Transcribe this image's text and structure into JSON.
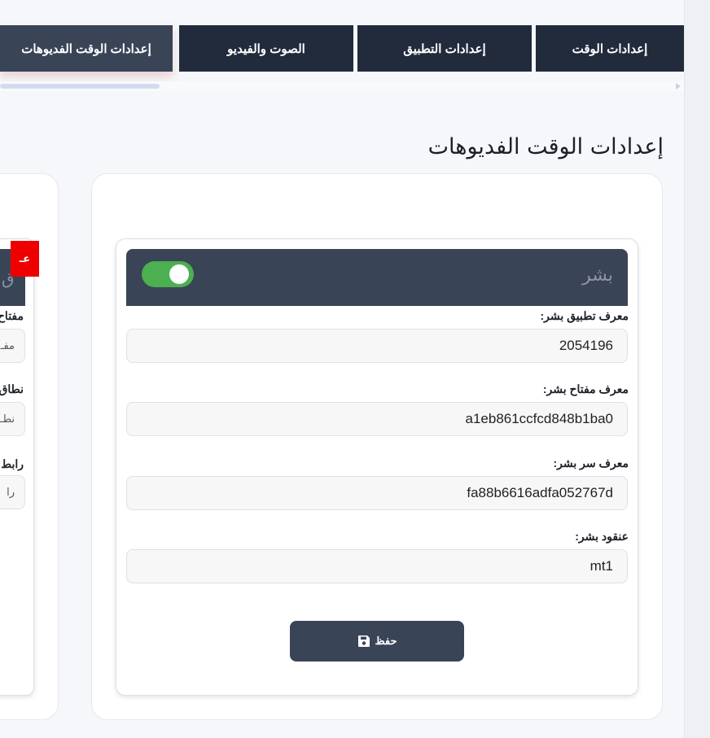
{
  "tabs": [
    {
      "label": "إعدادات الوقت",
      "active": false
    },
    {
      "label": "إعدادات التطبيق",
      "active": false
    },
    {
      "label": "الصوت والفيديو",
      "active": false
    },
    {
      "label": "إعدادات الوقت الفديوهات",
      "active": true
    }
  ],
  "page_title": "إعدادات الوقت الفديوهات",
  "provider": {
    "title": "بشر",
    "enabled": true,
    "fields": [
      {
        "label": "معرف تطبيق بشر:",
        "value": "2054196"
      },
      {
        "label": "معرف مفتاح بشر:",
        "value": "a1eb861ccfcd848b1ba0"
      },
      {
        "label": "معرف سر بشر:",
        "value": "fa88b6616adfa052767d"
      },
      {
        "label": "عنقود بشر:",
        "value": "mt1"
      }
    ],
    "save_label": "حفظ"
  },
  "left_card": {
    "header_letter": "ق",
    "fields": [
      {
        "label": "مفتاح",
        "value": "مفـ"
      },
      {
        "label": "نطاق",
        "value": "نطـ"
      },
      {
        "label": "رابط",
        "value": "را"
      }
    ]
  },
  "badge": {
    "text": "عـ"
  },
  "colors": {
    "tab_bg": "#222b3c",
    "tab_active_bg": "#394457",
    "header_bg": "#394457",
    "toggle_on": "#4caf50",
    "badge": "#ef0000"
  },
  "icons": {
    "save": "floppy-disk-icon",
    "toggle": "toggle-switch-icon"
  }
}
